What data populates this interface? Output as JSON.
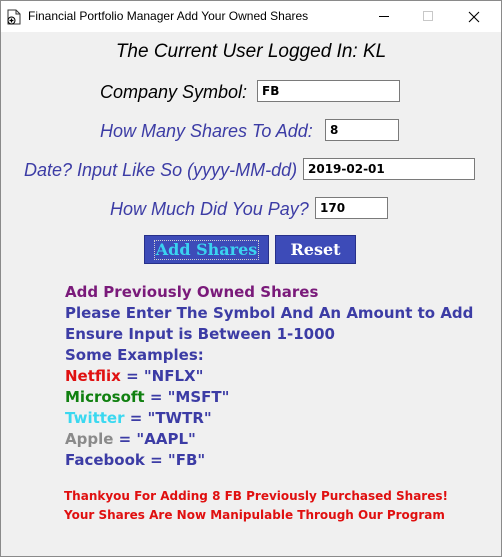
{
  "window": {
    "title": "Financial Portfolio Manager Add Your Owned Shares",
    "minimize_icon": "minimize-icon",
    "maximize_icon": "maximize-icon",
    "close_icon": "close-icon"
  },
  "user_line": "The Current User Logged In: KL",
  "form": {
    "symbol_label": "Company Symbol:",
    "symbol_value": "FB",
    "shares_label": "How Many Shares To Add:",
    "shares_value": "8",
    "date_label": "Date? Input Like So (yyyy-MM-dd)",
    "date_value": "2019-02-01",
    "price_label": "How Much Did You Pay?",
    "price_value": "170"
  },
  "buttons": {
    "add_label": "Add Shares",
    "reset_label": "Reset"
  },
  "info": {
    "heading": "Add Previously Owned Shares",
    "line1": "Please Enter The Symbol And An Amount to Add",
    "line2": "Ensure Input is Between 1-1000",
    "examples_title": "Some Examples:",
    "examples": [
      {
        "name": "Netflix",
        "code": " = \"NFLX\""
      },
      {
        "name": "Microsoft",
        "code": " = \"MSFT\""
      },
      {
        "name": "Twitter",
        "code": " = \"TWTR\""
      },
      {
        "name": "Apple",
        "code": " = \"AAPL\""
      },
      {
        "name": "Facebook",
        "code": " = \"FB\""
      }
    ]
  },
  "message": {
    "line1": "Thankyou For Adding 8 FB Previously Purchased Shares!",
    "line2": "Your Shares Are Now Manipulable Through Our Program"
  },
  "colors": {
    "accent_blue": "#3c3ca5",
    "button_bg": "#3d4bb8",
    "heading_purple": "#7a1a7a",
    "error_red": "#e01010"
  }
}
